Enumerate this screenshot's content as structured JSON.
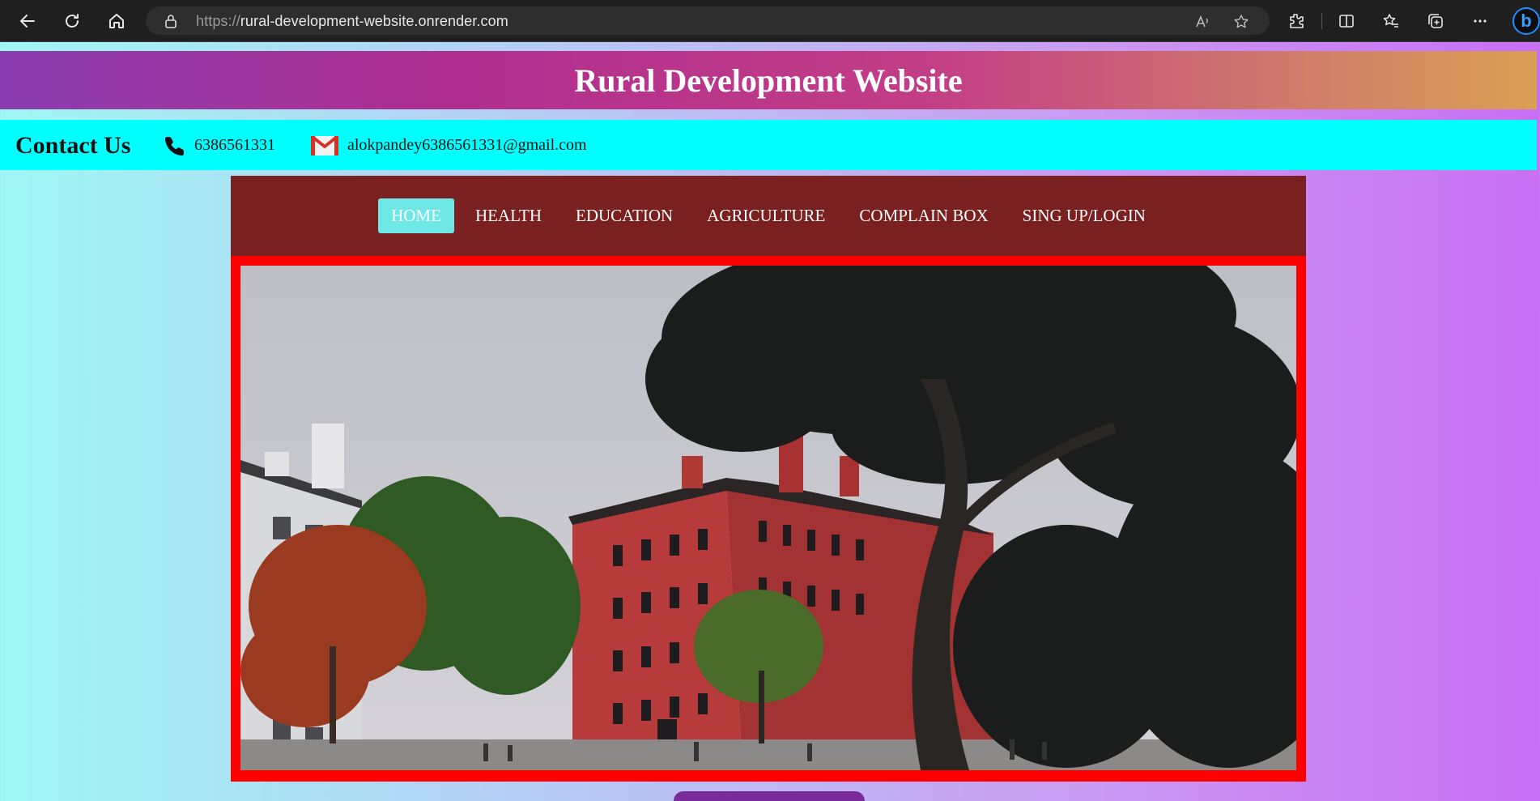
{
  "browser": {
    "url_scheme": "https://",
    "url_host": "rural-development-website.onrender.com",
    "icons": [
      "back-icon",
      "refresh-icon",
      "home-icon",
      "lock-icon",
      "read-aloud-icon",
      "favorite-star-icon",
      "extensions-icon",
      "split-screen-icon",
      "favorites-icon",
      "collections-icon",
      "more-icon",
      "bing-icon"
    ]
  },
  "header": {
    "title": "Rural Development Website"
  },
  "contact": {
    "title": "Contact Us",
    "phone": "6386561331",
    "email": "alokpandey6386561331@gmail.com"
  },
  "nav": {
    "items": [
      {
        "label": "HOME",
        "active": true
      },
      {
        "label": "HEALTH",
        "active": false
      },
      {
        "label": "EDUCATION",
        "active": false
      },
      {
        "label": "AGRICULTURE",
        "active": false
      },
      {
        "label": "COMPLAIN BOX",
        "active": false
      },
      {
        "label": "SING UP/LOGIN",
        "active": false
      }
    ]
  },
  "colors": {
    "nav_background": "#7a2020",
    "active_nav": "#6ee7e7",
    "contact_strip": "#00ffff",
    "hero_border": "#ff0000"
  }
}
